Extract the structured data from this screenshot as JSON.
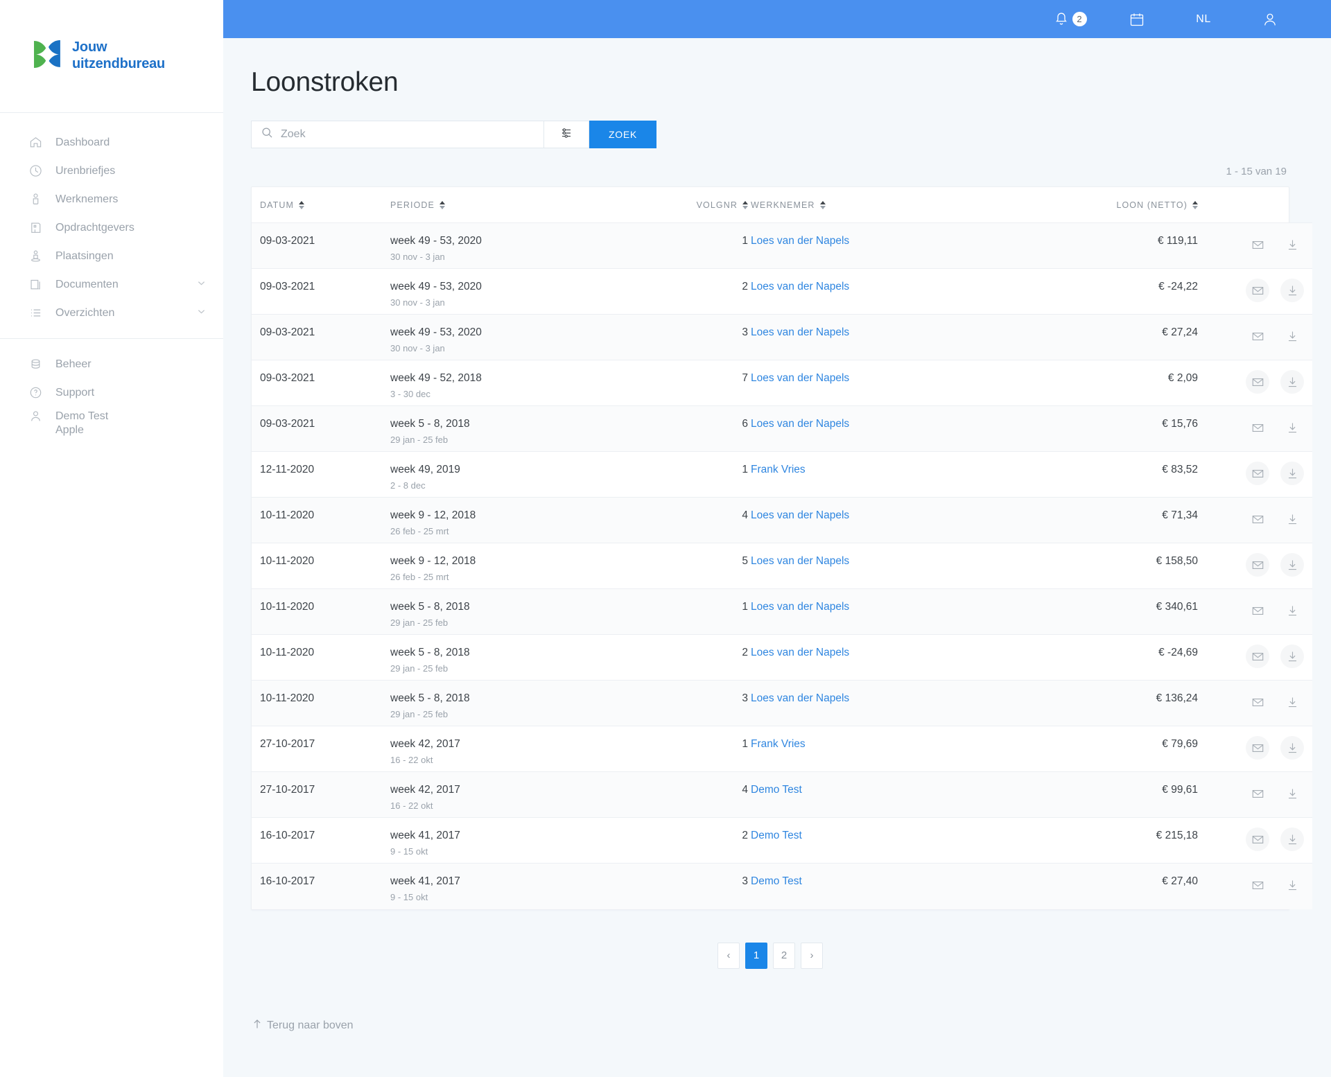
{
  "brand": {
    "line1": "Jouw",
    "line2": "uitzendbureau"
  },
  "topbar": {
    "notifications_count": "2",
    "language": "NL",
    "bell_icon": "bell-icon",
    "calendar_icon": "calendar-icon",
    "user_icon": "user-icon"
  },
  "sidebar": {
    "items": [
      {
        "label": "Dashboard",
        "icon": "home-icon",
        "expandable": false
      },
      {
        "label": "Urenbriefjes",
        "icon": "clock-icon",
        "expandable": false
      },
      {
        "label": "Werknemers",
        "icon": "person-icon",
        "expandable": false
      },
      {
        "label": "Opdrachtgevers",
        "icon": "building-icon",
        "expandable": false
      },
      {
        "label": "Plaatsingen",
        "icon": "placement-icon",
        "expandable": false
      },
      {
        "label": "Documenten",
        "icon": "documents-icon",
        "expandable": true
      },
      {
        "label": "Overzichten",
        "icon": "list-icon",
        "expandable": true
      }
    ],
    "secondary": [
      {
        "label": "Beheer",
        "icon": "database-icon"
      },
      {
        "label": "Support",
        "icon": "question-circle-icon"
      }
    ],
    "user": {
      "name": "Demo Test",
      "company": "Apple",
      "icon": "user-outline-icon"
    }
  },
  "page": {
    "title": "Loonstroken",
    "result_count": "1 - 15 van 19",
    "back_to_top": "Terug naar boven"
  },
  "search": {
    "placeholder": "Zoek",
    "value": "",
    "search_icon": "search-icon",
    "filter_icon": "sliders-icon",
    "submit_label": "ZOEK"
  },
  "table": {
    "columns": [
      {
        "key": "datum",
        "label": "DATUM",
        "sortable": true
      },
      {
        "key": "periode",
        "label": "PERIODE",
        "sortable": true
      },
      {
        "key": "volgnr",
        "label": "VOLGNR",
        "sortable": true
      },
      {
        "key": "werknemer",
        "label": "WERKNEMER",
        "sortable": true
      },
      {
        "key": "loon",
        "label": "LOON (NETTO)",
        "sortable": true
      },
      {
        "key": "acties",
        "label": "",
        "sortable": false
      }
    ],
    "row_actions": [
      {
        "name": "email-icon",
        "title": "E-mail"
      },
      {
        "name": "download-icon",
        "title": "Download"
      }
    ],
    "rows": [
      {
        "datum": "09-03-2021",
        "periode": "week 49 - 53, 2020",
        "periode_sub": "30 nov - 3 jan",
        "volgnr": "1",
        "werknemer": "Loes van der Napels",
        "loon": "€ 119,11"
      },
      {
        "datum": "09-03-2021",
        "periode": "week 49 - 53, 2020",
        "periode_sub": "30 nov - 3 jan",
        "volgnr": "2",
        "werknemer": "Loes van der Napels",
        "loon": "€ -24,22"
      },
      {
        "datum": "09-03-2021",
        "periode": "week 49 - 53, 2020",
        "periode_sub": "30 nov - 3 jan",
        "volgnr": "3",
        "werknemer": "Loes van der Napels",
        "loon": "€ 27,24"
      },
      {
        "datum": "09-03-2021",
        "periode": "week 49 - 52, 2018",
        "periode_sub": "3 - 30 dec",
        "volgnr": "7",
        "werknemer": "Loes van der Napels",
        "loon": "€ 2,09"
      },
      {
        "datum": "09-03-2021",
        "periode": "week 5 - 8, 2018",
        "periode_sub": "29 jan - 25 feb",
        "volgnr": "6",
        "werknemer": "Loes van der Napels",
        "loon": "€ 15,76"
      },
      {
        "datum": "12-11-2020",
        "periode": "week 49, 2019",
        "periode_sub": "2 - 8 dec",
        "volgnr": "1",
        "werknemer": "Frank Vries",
        "loon": "€ 83,52"
      },
      {
        "datum": "10-11-2020",
        "periode": "week 9 - 12, 2018",
        "periode_sub": "26 feb - 25 mrt",
        "volgnr": "4",
        "werknemer": "Loes van der Napels",
        "loon": "€ 71,34"
      },
      {
        "datum": "10-11-2020",
        "periode": "week 9 - 12, 2018",
        "periode_sub": "26 feb - 25 mrt",
        "volgnr": "5",
        "werknemer": "Loes van der Napels",
        "loon": "€ 158,50"
      },
      {
        "datum": "10-11-2020",
        "periode": "week 5 - 8, 2018",
        "periode_sub": "29 jan - 25 feb",
        "volgnr": "1",
        "werknemer": "Loes van der Napels",
        "loon": "€ 340,61"
      },
      {
        "datum": "10-11-2020",
        "periode": "week 5 - 8, 2018",
        "periode_sub": "29 jan - 25 feb",
        "volgnr": "2",
        "werknemer": "Loes van der Napels",
        "loon": "€ -24,69"
      },
      {
        "datum": "10-11-2020",
        "periode": "week 5 - 8, 2018",
        "periode_sub": "29 jan - 25 feb",
        "volgnr": "3",
        "werknemer": "Loes van der Napels",
        "loon": "€ 136,24"
      },
      {
        "datum": "27-10-2017",
        "periode": "week 42, 2017",
        "periode_sub": "16 - 22 okt",
        "volgnr": "1",
        "werknemer": "Frank Vries",
        "loon": "€ 79,69"
      },
      {
        "datum": "27-10-2017",
        "periode": "week 42, 2017",
        "periode_sub": "16 - 22 okt",
        "volgnr": "4",
        "werknemer": "Demo Test",
        "loon": "€ 99,61"
      },
      {
        "datum": "16-10-2017",
        "periode": "week 41, 2017",
        "periode_sub": "9 - 15 okt",
        "volgnr": "2",
        "werknemer": "Demo Test",
        "loon": "€ 215,18"
      },
      {
        "datum": "16-10-2017",
        "periode": "week 41, 2017",
        "periode_sub": "9 - 15 okt",
        "volgnr": "3",
        "werknemer": "Demo Test",
        "loon": "€ 27,40"
      }
    ]
  },
  "pagination": {
    "prev_label": "‹",
    "next_label": "›",
    "pages": [
      "1",
      "2"
    ],
    "current": "1"
  },
  "colors": {
    "header_blue": "#4a90ef",
    "accent_blue": "#1a86e8",
    "link_blue": "#2f86e0",
    "brand_blue": "#1d70c8",
    "page_bg": "#f4f8fb",
    "row_alt": "#fafbfc"
  }
}
